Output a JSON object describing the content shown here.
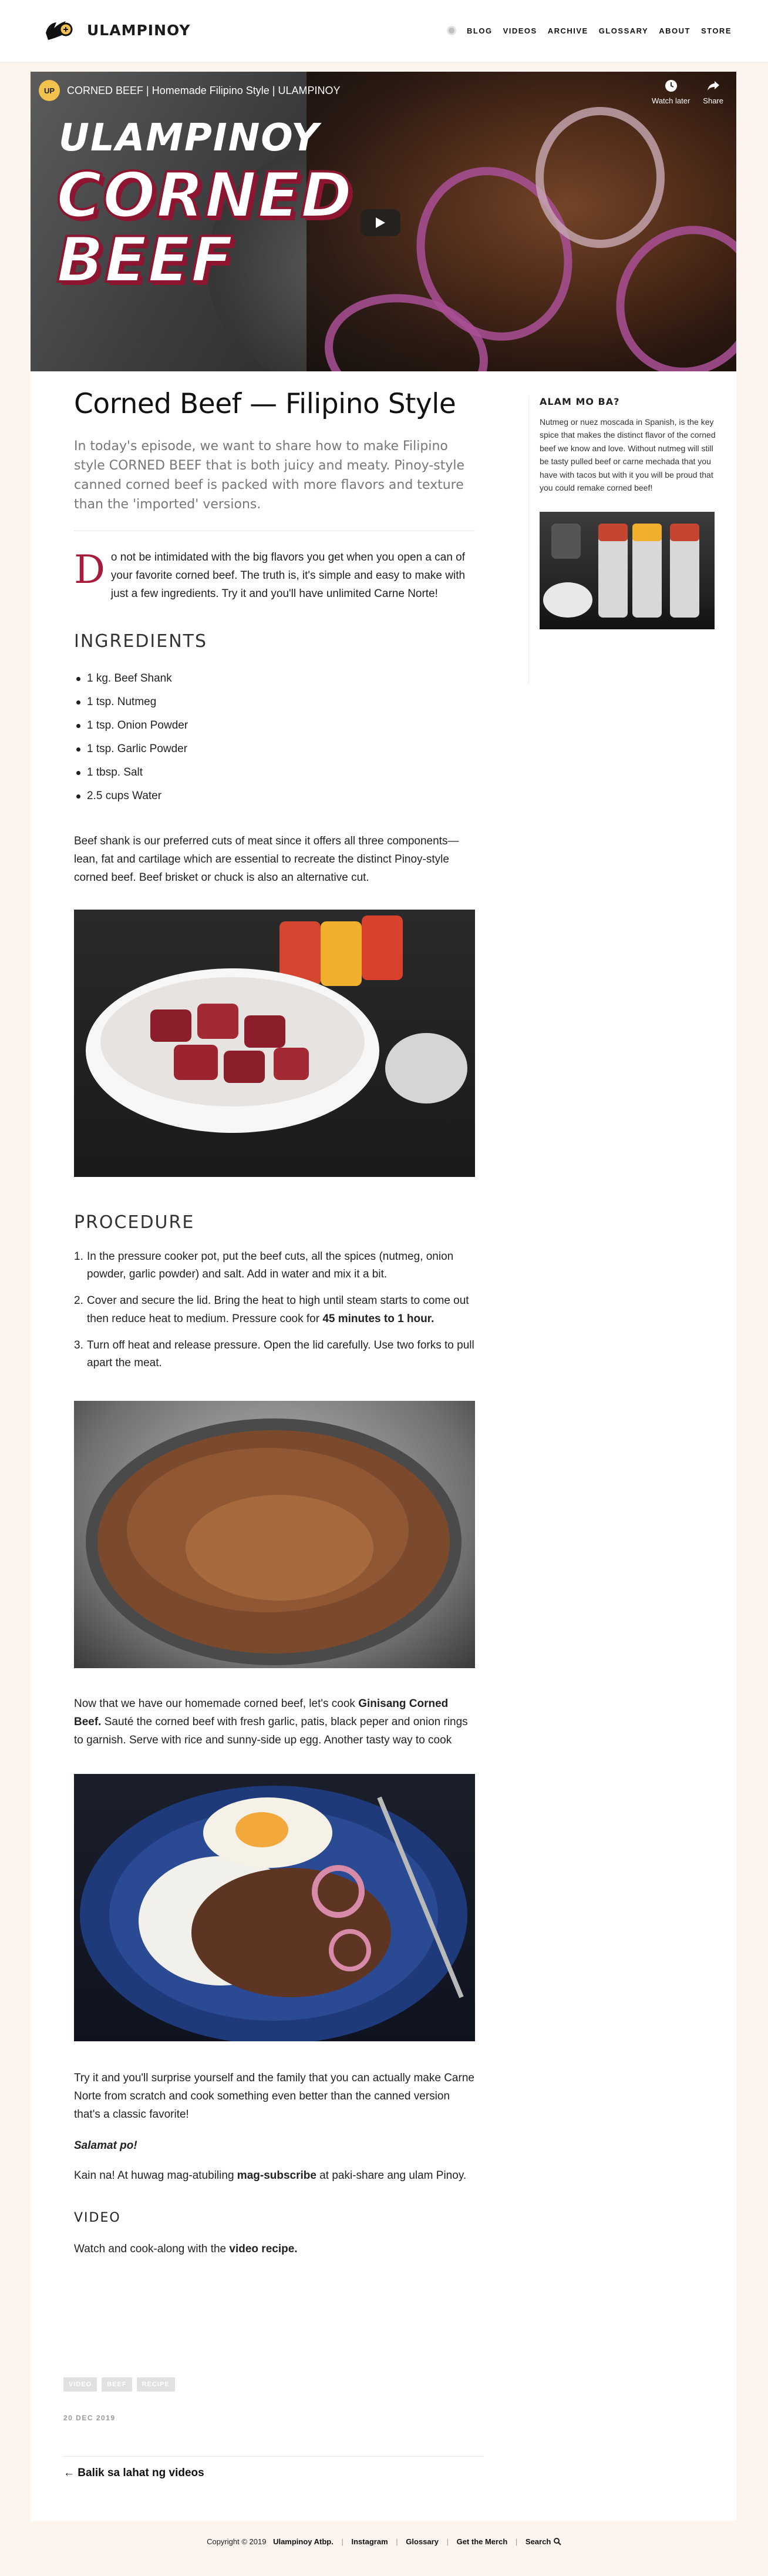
{
  "header": {
    "logo_text": "ULAMPINOY",
    "nav": [
      "BLOG",
      "VIDEOS",
      "ARCHIVE",
      "GLOSSARY",
      "ABOUT",
      "STORE"
    ]
  },
  "video": {
    "channel_avatar": "UP",
    "title": "CORNED BEEF | Homemade Filipino Style | ULAMPINOY",
    "watch_later": "Watch later",
    "share": "Share",
    "brand": "ULAMPINOY",
    "big_line1": "CORNED",
    "big_line2": "BEEF"
  },
  "article": {
    "title": "Corned Beef — Filipino Style",
    "lede": "In today's episode, we want to share how to make Filipino style CORNED BEEF that is both juicy and meaty. Pinoy-style canned corned beef is packed with more flavors and texture than the 'imported' versions.",
    "intro_dropcap": "D",
    "intro_rest": "o not be intimidated with the big flavors you get when you open a can of your favorite corned beef. The truth is, it's simple and easy to make with just a few ingredients. Try it and you'll have unlimited Carne Norte!",
    "ingredients_heading": "INGREDIENTS",
    "ingredients": [
      "1 kg. Beef Shank",
      "1 tsp. Nutmeg",
      "1 tsp. Onion Powder",
      "1 tsp. Garlic Powder",
      "1 tbsp. Salt",
      "2.5 cups Water"
    ],
    "cut_note": "Beef shank is our preferred cuts of meat since it offers all three components—lean, fat and cartilage which are essential to recreate the distinct Pinoy-style corned beef. Beef brisket or chuck is also an alternative cut.",
    "procedure_heading": "PROCEDURE",
    "steps": [
      {
        "text": "In the pressure cooker pot, put the beef cuts, all the spices (nutmeg, onion powder, garlic powder) and salt. Add in water and mix it a bit.",
        "bold": ""
      },
      {
        "text": "Cover and secure the lid. Bring the heat to high until steam starts to come out then reduce heat to medium. Pressure cook for ",
        "bold": "45 minutes to 1 hour."
      },
      {
        "text": "Turn off heat and release pressure. Open the lid carefully. Use two forks to pull apart the meat.",
        "bold": ""
      }
    ],
    "ginisang_pre": "Now that we have our homemade corned beef, let's cook ",
    "ginisang_bold": "Ginisang Corned Beef.",
    "ginisang_post": " Sauté the corned beef with fresh garlic, patis, black peper and onion rings to garnish. Serve with rice and sunny-side up egg. Another tasty way to cook",
    "closing": "Try it and you'll surprise yourself and the family that you can actually make Carne Norte from scratch and cook something even better than the canned version that's a classic favorite!",
    "salamat": "Salamat po!",
    "kain_pre": "Kain na! At huwag mag-atubiling ",
    "kain_bold": "mag-subscribe",
    "kain_post": " at paki-share ang ulam Pinoy.",
    "video_heading": "VIDEO",
    "video_pre": "Watch and cook-along with the ",
    "video_bold": "video recipe."
  },
  "sidebar": {
    "title": "ALAM MO BA?",
    "text": "Nutmeg or nuez moscada in Spanish, is the key spice that makes the distinct flavor of the corned beef we know and love. Without nutmeg will still be tasty pulled beef or carne mechada that you have with tacos but with it you will be proud that you could remake corned beef!"
  },
  "tags": [
    "VIDEO",
    "BEEF",
    "RECIPE"
  ],
  "date": "20 DEC 2019",
  "back_link": "← Balik sa lahat ng videos",
  "footer": {
    "copyright": "Copyright © 2019",
    "brand": "Ulampinoy Atbp.",
    "links": [
      "Instagram",
      "Glossary",
      "Get the Merch",
      "Search"
    ]
  }
}
